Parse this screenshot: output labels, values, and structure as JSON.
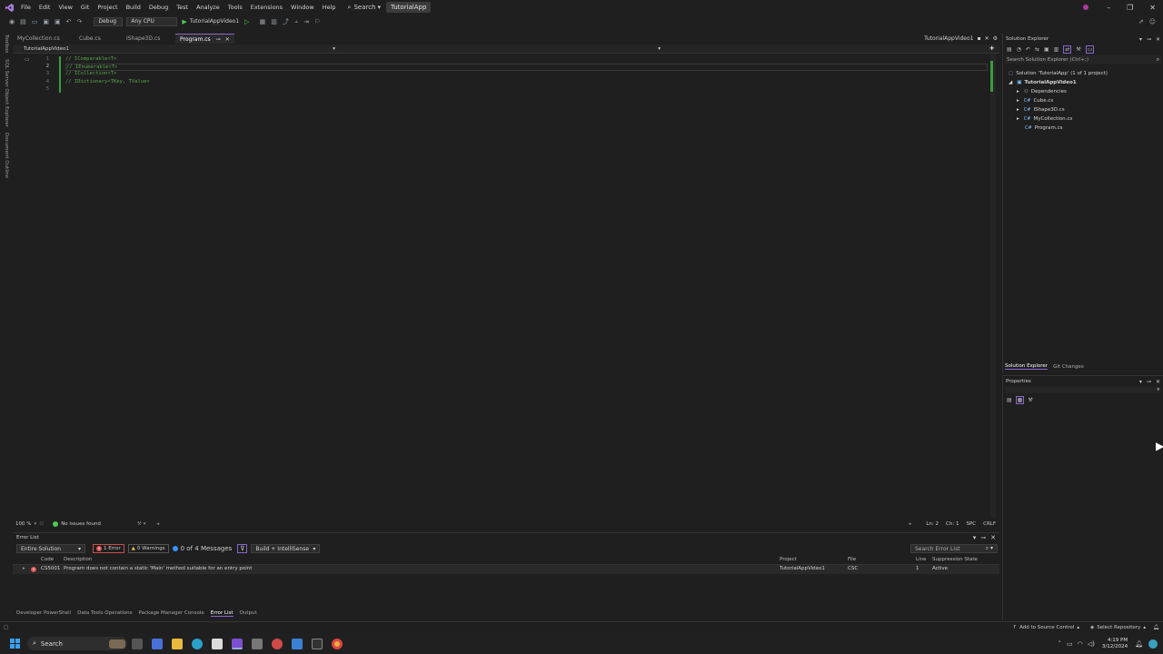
{
  "menu": {
    "items": [
      "File",
      "Edit",
      "View",
      "Git",
      "Project",
      "Build",
      "Debug",
      "Test",
      "Analyze",
      "Tools",
      "Extensions",
      "Window",
      "Help"
    ],
    "search_label": "Search",
    "app_title": "TutorialApp"
  },
  "toolbar": {
    "config": "Debug",
    "platform": "Any CPU",
    "run_target": "TutorialAppVideo1"
  },
  "left_rail": [
    "Toolbox",
    "SQL Server Object Explorer",
    "Document Outline"
  ],
  "tabs": [
    {
      "label": "MyCollection.cs"
    },
    {
      "label": "Cube.cs"
    },
    {
      "label": "IShape3D.cs"
    },
    {
      "label": "Program.cs"
    }
  ],
  "editor": {
    "nav_project": "TutorialAppVideo1",
    "right_tab": "TutorialAppVideo1",
    "lines": [
      {
        "num": "1",
        "text": "// IComparable<T>"
      },
      {
        "num": "2",
        "text": "// IEnumerable<T>"
      },
      {
        "num": "3",
        "text": "// ICollection<T>"
      },
      {
        "num": "4",
        "text": "// IDictionary<TKey, TValue>"
      },
      {
        "num": "5",
        "text": ""
      }
    ]
  },
  "editor_status": {
    "zoom": "100 %",
    "issues": "No issues found",
    "ln": "Ln: 2",
    "ch": "Ch: 1",
    "spc": "SPC",
    "eol": "CRLF"
  },
  "error_list": {
    "title": "Error List",
    "scope": "Entire Solution",
    "errors": "1 Error",
    "warnings": "0 Warnings",
    "messages": "0 of 4 Messages",
    "build_filter": "Build + IntelliSense",
    "search_placeholder": "Search Error List",
    "columns": {
      "code": "Code",
      "description": "Description",
      "project": "Project",
      "file": "File",
      "line": "Line",
      "suppression": "Suppression State"
    },
    "rows": [
      {
        "code": "CS5001",
        "description": "Program does not contain a static 'Main' method suitable for an entry point",
        "project": "TutorialAppVideo1",
        "file": "CSC",
        "line": "1",
        "suppression": "Active"
      }
    ]
  },
  "bottom_tabs": [
    "Developer PowerShell",
    "Data Tools Operations",
    "Package Manager Console",
    "Error List",
    "Output"
  ],
  "solution_explorer": {
    "title": "Solution Explorer",
    "search_placeholder": "Search Solution Explorer (Ctrl+;)",
    "solution": "Solution 'TutorialApp' (1 of 1 project)",
    "project": "TutorialAppVideo1",
    "items": [
      "Dependencies",
      "Cube.cs",
      "IShape3D.cs",
      "MyCollection.cs",
      "Program.cs"
    ],
    "bottom_tabs": [
      "Solution Explorer",
      "Git Changes"
    ]
  },
  "properties": {
    "title": "Properties"
  },
  "status_bar": {
    "source_control": "Add to Source Control",
    "repository": "Select Repository"
  },
  "taskbar": {
    "search": "Search",
    "time": "4:19 PM",
    "date": "3/12/2024"
  }
}
